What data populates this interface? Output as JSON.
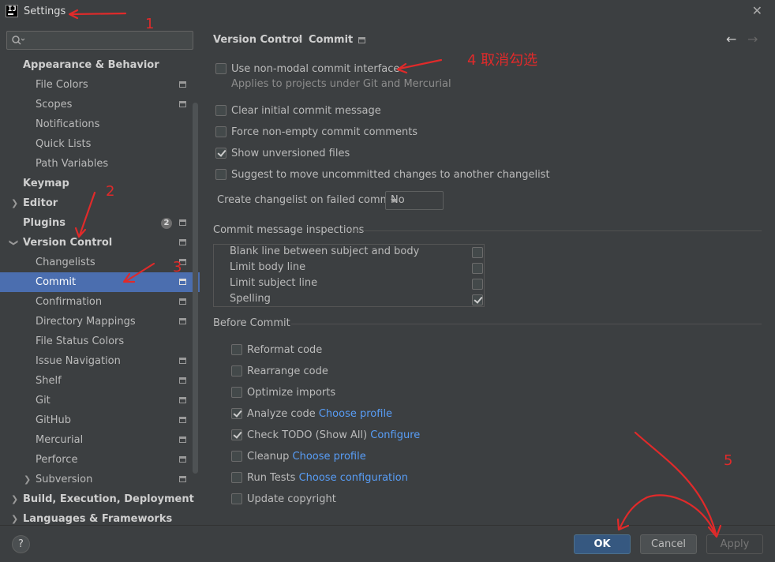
{
  "window": {
    "title": "Settings"
  },
  "sidebar": {
    "items": [
      {
        "label": "Appearance & Behavior"
      },
      {
        "label": "File Colors"
      },
      {
        "label": "Scopes"
      },
      {
        "label": "Notifications"
      },
      {
        "label": "Quick Lists"
      },
      {
        "label": "Path Variables"
      },
      {
        "label": "Keymap"
      },
      {
        "label": "Editor"
      },
      {
        "label": "Plugins",
        "badge": "2"
      },
      {
        "label": "Version Control"
      },
      {
        "label": "Changelists"
      },
      {
        "label": "Commit"
      },
      {
        "label": "Confirmation"
      },
      {
        "label": "Directory Mappings"
      },
      {
        "label": "File Status Colors"
      },
      {
        "label": "Issue Navigation"
      },
      {
        "label": "Shelf"
      },
      {
        "label": "Git"
      },
      {
        "label": "GitHub"
      },
      {
        "label": "Mercurial"
      },
      {
        "label": "Perforce"
      },
      {
        "label": "Subversion"
      },
      {
        "label": "Build, Execution, Deployment"
      },
      {
        "label": "Languages & Frameworks"
      }
    ]
  },
  "breadcrumb": {
    "parent": "Version Control",
    "current": "Commit"
  },
  "options": {
    "non_modal": {
      "label": "Use non-modal commit interface",
      "checked": false
    },
    "non_modal_hint": "Applies to projects under Git and Mercurial",
    "clear_initial": {
      "label": "Clear initial commit message",
      "checked": false
    },
    "force_non_empty": {
      "label": "Force non-empty commit comments",
      "checked": false
    },
    "show_unversioned": {
      "label": "Show unversioned files",
      "checked": true
    },
    "suggest_move": {
      "label": "Suggest to move uncommitted changes to another changelist",
      "checked": false
    },
    "changelist_failed": {
      "label": "Create changelist on failed commit:",
      "value": "No"
    }
  },
  "inspections": {
    "title": "Commit message inspections",
    "items": [
      {
        "label": "Blank line between subject and body",
        "checked": false
      },
      {
        "label": "Limit body line",
        "checked": false
      },
      {
        "label": "Limit subject line",
        "checked": false
      },
      {
        "label": "Spelling",
        "checked": true
      }
    ]
  },
  "before_commit": {
    "title": "Before Commit",
    "items": [
      {
        "label": "Reformat code",
        "checked": false,
        "link": ""
      },
      {
        "label": "Rearrange code",
        "checked": false,
        "link": ""
      },
      {
        "label": "Optimize imports",
        "checked": false,
        "link": ""
      },
      {
        "label": "Analyze code",
        "checked": true,
        "link": "Choose profile"
      },
      {
        "label": "Check TODO (Show All)",
        "checked": true,
        "link": "Configure"
      },
      {
        "label": "Cleanup",
        "checked": false,
        "link": "Choose profile"
      },
      {
        "label": "Run Tests",
        "checked": false,
        "link": "Choose configuration"
      },
      {
        "label": "Update copyright",
        "checked": false,
        "link": ""
      }
    ]
  },
  "buttons": {
    "help": "?",
    "ok": "OK",
    "cancel": "Cancel",
    "apply": "Apply"
  },
  "annotations": {
    "n1": "1",
    "n2": "2",
    "n3": "3",
    "n4": "4 取消勾选",
    "n5": "5",
    "color": "#e02a2a"
  },
  "colors": {
    "selection": "#4b6eaf",
    "link": "#589df6",
    "ok_button": "#365880"
  }
}
